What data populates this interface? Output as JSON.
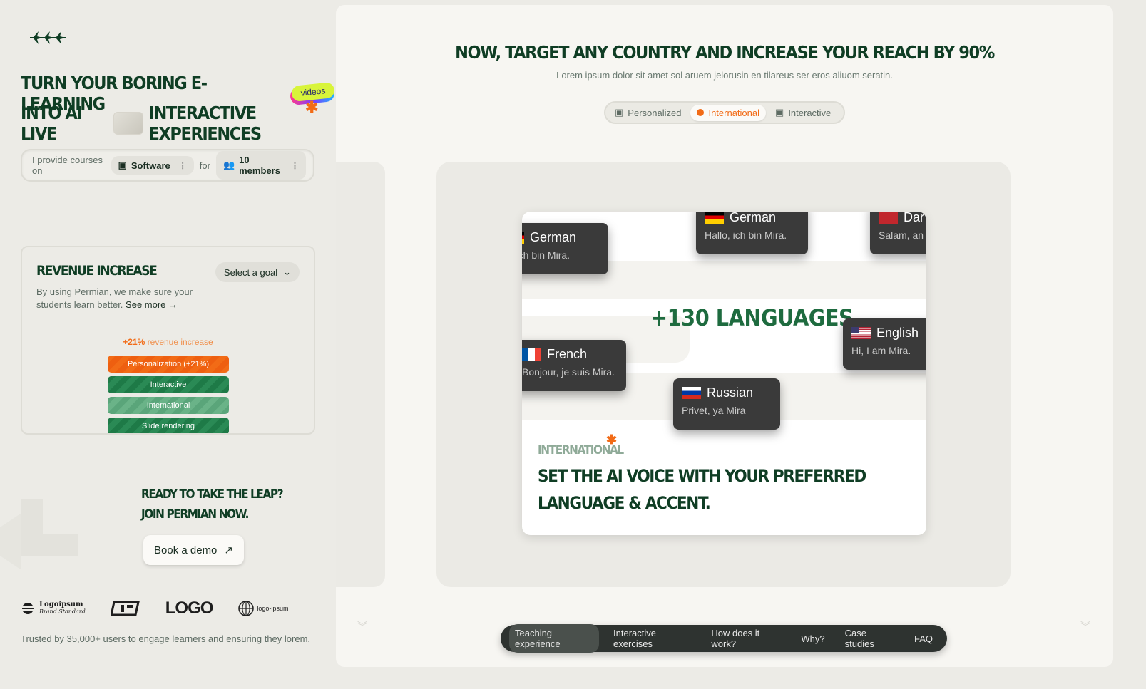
{
  "hero": {
    "line1": "TURN YOUR BORING E-LEARNING",
    "chip": "videos",
    "line2a": "INTO AI LIVE",
    "line2b": "INTERACTIVE EXPERIENCES"
  },
  "provide": {
    "prefix": "I provide courses on",
    "topic": "Software",
    "for": "for",
    "members": "10 members"
  },
  "revenue": {
    "title": "REVENUE INCREASE",
    "goal_select": "Select a goal",
    "desc": "By using Permian, we make sure your students learn better.",
    "see_more": "See more",
    "increase_value": "+21%",
    "increase_text": "revenue increase",
    "bars": [
      "Personalization (+21%)",
      "Interactive",
      "International",
      "Slide rendering"
    ]
  },
  "cta": {
    "line1": "READY TO TAKE THE LEAP?",
    "line2": "JOIN PERMIAN NOW.",
    "button": "Book a demo"
  },
  "logos": [
    "Logoipsum",
    "Brand Standard",
    "LOGO",
    "logo-ipsum"
  ],
  "trusted": "Trusted by 35,000+ users to engage learners and ensuring they lorem.",
  "main": {
    "title": "NOW, TARGET ANY COUNTRY AND INCREASE YOUR REACH BY 90%",
    "subtitle": "Lorem ipsum dolor sit amet sol aruem jelorusin en tilareus ser eros aliuom seratin.",
    "tabs": [
      "Personalized",
      "International",
      "Interactive"
    ],
    "languages_headline": "+130 LANGUAGES",
    "language_cards": [
      {
        "name": "German",
        "phrase": "o, ich bin Mira."
      },
      {
        "name": "German",
        "phrase": "Hallo, ich bin Mira."
      },
      {
        "name": "Dar",
        "phrase": "Salam, an"
      },
      {
        "name": "English",
        "phrase": "Hi, I am Mira."
      },
      {
        "name": "French",
        "phrase": "Bonjour, je suis Mira."
      },
      {
        "name": "Russian",
        "phrase": "Privet, ya Mira"
      }
    ],
    "section_label": "INTERNATIONAL",
    "section_desc": "SET THE AI VOICE WITH YOUR PREFERRED LANGUAGE & ACCENT."
  },
  "nav": [
    "Teaching experience",
    "Interactive exercises",
    "How does it work?",
    "Why?",
    "Case studies",
    "FAQ"
  ],
  "colors": {
    "accent": "#f26b16",
    "brand_green": "#0f3d24"
  }
}
